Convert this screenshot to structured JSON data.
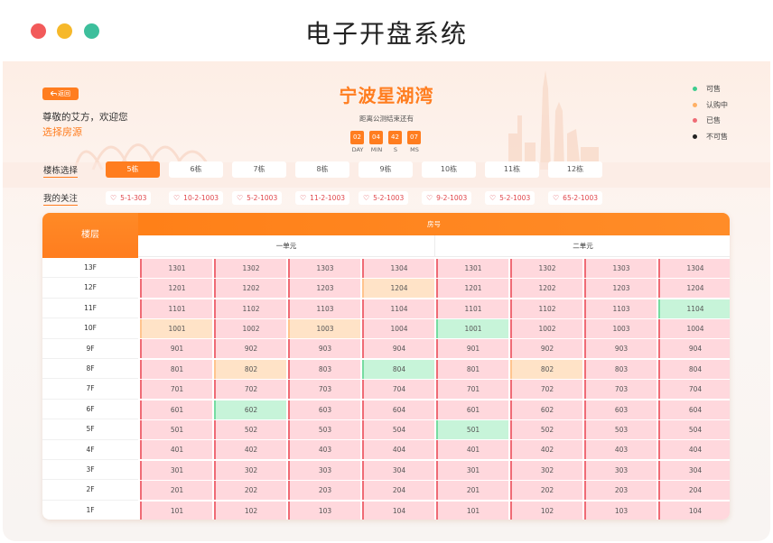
{
  "window": {
    "title": "电子开盘系统"
  },
  "header": {
    "back_label": "返回",
    "greeting": "尊敬的艾方，欢迎您",
    "select_house": "选择房源",
    "project_title": "宁波星湖湾",
    "countdown_label": "距离公测结束还有",
    "countdown": [
      {
        "value": "02",
        "unit": "DAY"
      },
      {
        "value": "04",
        "unit": "MIN"
      },
      {
        "value": "42",
        "unit": "S"
      },
      {
        "value": "07",
        "unit": "MS"
      }
    ]
  },
  "legend": [
    {
      "label": "可售",
      "color": "#3dcc8e"
    },
    {
      "label": "认购中",
      "color": "#ffb065"
    },
    {
      "label": "已售",
      "color": "#ef6b75"
    },
    {
      "label": "不可售",
      "color": "#222222"
    }
  ],
  "buildings": {
    "label": "楼栋选择",
    "tabs": [
      "5栋",
      "6栋",
      "7栋",
      "8栋",
      "9栋",
      "10栋",
      "11栋",
      "12栋"
    ],
    "active": 0
  },
  "favorites": {
    "label": "我的关注",
    "items": [
      "5-1-303",
      "10-2-1003",
      "5-2-1003",
      "11-2-1003",
      "5-2-1003",
      "9-2-1003",
      "5-2-1003",
      "65-2-1003"
    ]
  },
  "table": {
    "floor_header": "楼层",
    "room_header": "房号",
    "units": [
      "一单元",
      "二单元"
    ],
    "floors": [
      "13F",
      "12F",
      "11F",
      "10F",
      "9F",
      "8F",
      "7F",
      "6F",
      "5F",
      "4F",
      "3F",
      "2F",
      "1F"
    ],
    "columns": [
      "01",
      "02",
      "03",
      "04"
    ],
    "special_status": {
      "0-11-3": "reserved",
      "1-10-3": "available",
      "0-9-0": "reserved",
      "0-9-2": "reserved",
      "1-9-0": "available",
      "0-7-1": "reserved",
      "0-7-3": "available",
      "1-7-1": "reserved",
      "0-5-1": "available",
      "1-4-0": "available"
    }
  }
}
